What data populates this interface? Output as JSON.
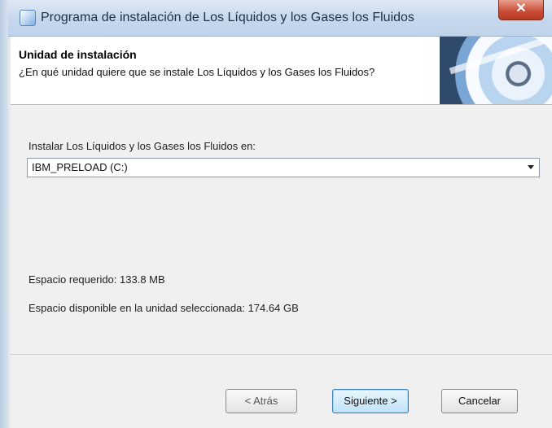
{
  "window": {
    "title": "Programa de instalación de Los Líquidos y los Gases  los Fluidos",
    "close_label": "✕"
  },
  "header": {
    "title": "Unidad de instalación",
    "subtitle": "¿En qué unidad quiere que se instale Los Líquidos y los Gases  los Fluidos?"
  },
  "main": {
    "install_label": "Instalar Los Líquidos y los Gases  los Fluidos en:",
    "drive_selected": "IBM_PRELOAD (C:)",
    "space_required": "Espacio requerido: 133.8 MB",
    "space_available": "Espacio disponible en la unidad seleccionada: 174.64 GB"
  },
  "buttons": {
    "back": "< Atrás",
    "next": "Siguiente >",
    "cancel": "Cancelar"
  }
}
